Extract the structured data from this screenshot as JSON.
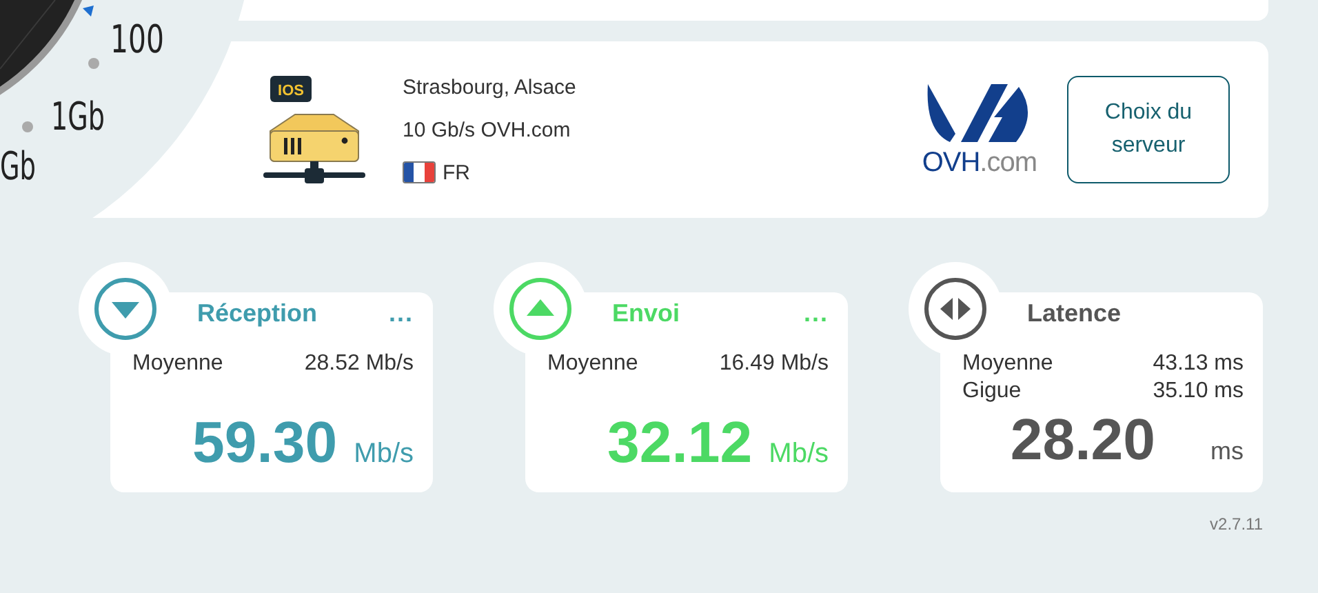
{
  "gauge": {
    "labels": [
      "100",
      "1Gb",
      "Gb"
    ]
  },
  "server": {
    "icon_tag": "IOS",
    "location": "Strasbourg, Alsace",
    "sponsor": "10 Gb/s OVH.com",
    "country": "FR",
    "logo_text": "OVH",
    "logo_suffix": ".com",
    "button": "Choix du serveur"
  },
  "stats": [
    {
      "kind": "download",
      "title": "Réception",
      "more": "...",
      "color": "#3f9cad",
      "rows": [
        {
          "label": "Moyenne",
          "value": "28.52 Mb/s"
        }
      ],
      "value": "59.30",
      "unit": "Mb/s"
    },
    {
      "kind": "upload",
      "title": "Envoi",
      "more": "...",
      "color": "#4cd964",
      "rows": [
        {
          "label": "Moyenne",
          "value": "16.49 Mb/s"
        }
      ],
      "value": "32.12",
      "unit": "Mb/s"
    },
    {
      "kind": "latency",
      "title": "Latence",
      "color": "#555555",
      "rows": [
        {
          "label": "Moyenne",
          "value": "43.13 ms"
        },
        {
          "label": "Gigue",
          "value": "35.10 ms"
        }
      ],
      "value": "28.20",
      "unit": "ms"
    }
  ],
  "version": "v2.7.11"
}
